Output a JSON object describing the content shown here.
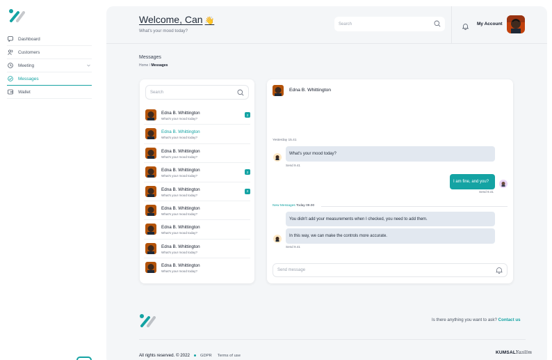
{
  "sidebar": {
    "items": [
      {
        "label": "Dashboard",
        "icon": "chat-bubble-icon"
      },
      {
        "label": "Customers",
        "icon": "users-icon"
      },
      {
        "label": "Meeting",
        "icon": "clock-icon"
      },
      {
        "label": "Messages",
        "icon": "message-icon"
      },
      {
        "label": "Wallet",
        "icon": "wallet-icon"
      }
    ],
    "active": "Messages"
  },
  "header": {
    "welcome": "Welcome, Can",
    "subtitle": "What's your mood today?",
    "search_placeholder": "Search",
    "account_label": "My Account"
  },
  "page": {
    "title": "Messages",
    "breadcrumb": [
      "Home",
      "Messages"
    ]
  },
  "contacts": {
    "search_placeholder": "Search",
    "items": [
      {
        "name": "Edna B. Whittington",
        "message": "What's your mood today?",
        "badge": "2"
      },
      {
        "name": "Edna B. Whittington",
        "message": "What's your mood today?",
        "badge": ""
      },
      {
        "name": "Edna B. Whittington",
        "message": "What's your mood today?",
        "badge": ""
      },
      {
        "name": "Edna B. Whittington",
        "message": "What's your mood today?",
        "badge": "2"
      },
      {
        "name": "Edna B. Whittington",
        "message": "What's your mood today?",
        "badge": "2"
      },
      {
        "name": "Edna B. Whittington",
        "message": "What's your mood today?",
        "badge": ""
      },
      {
        "name": "Edna B. Whittington",
        "message": "What's your mood today?",
        "badge": ""
      },
      {
        "name": "Edna B. Whittington",
        "message": "What's your mood today?",
        "badge": ""
      },
      {
        "name": "Edna B. Whittington",
        "message": "What's your mood today?",
        "badge": ""
      }
    ]
  },
  "chat": {
    "contact_name": "Edna B. Whittington",
    "day_label": "Yesterday 15.41",
    "messages": [
      {
        "text": "What's your mood today?",
        "sent": "Send 9.41"
      },
      {
        "text": "I am fine, and you?",
        "sent": "Send 9.41"
      }
    ],
    "new_messages_label": "New Messages",
    "new_messages_time": "Today 09.00",
    "new_messages": [
      {
        "text": "You didn't add your measurements when I checked, you need to add them."
      },
      {
        "text": "In this way, we can make the controls more accurate."
      }
    ],
    "new_sent": "Send 9.41",
    "input_placeholder": "Send message"
  },
  "footer": {
    "ask_text": "Is there anything you want to ask?",
    "contact_link": "Contact us",
    "rights": "All rights reserved. © 2022",
    "gdpr": "GDPR",
    "terms": "Terms of use",
    "brand": "KUMSAL",
    "brand_script": "Yazilim"
  },
  "colors": {
    "accent": "#14a3a3",
    "bubble_in": "#e2e8f0",
    "background": "#f4f6f8"
  }
}
